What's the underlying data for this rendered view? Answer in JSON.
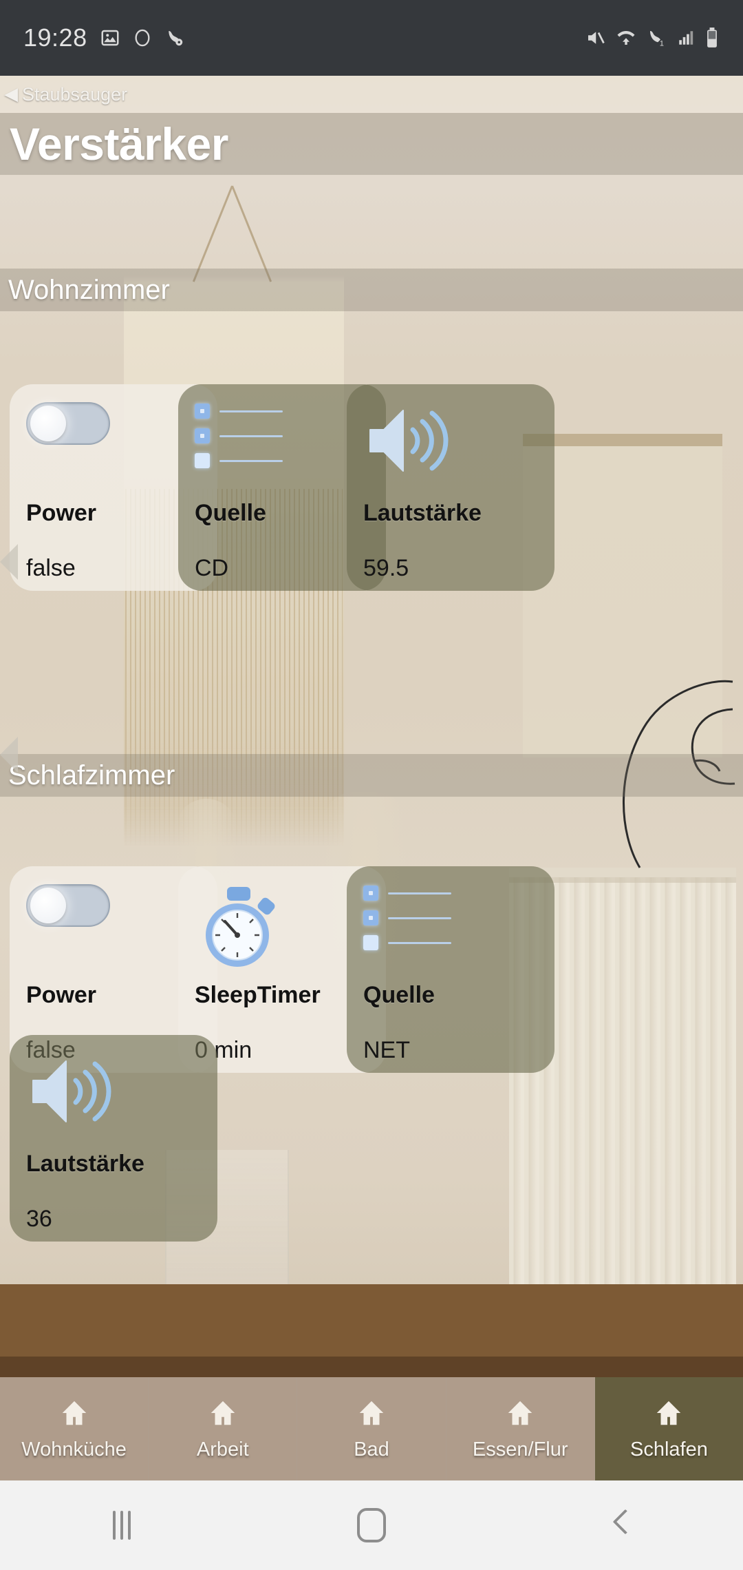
{
  "statusbar": {
    "time": "19:28",
    "left_icons": [
      "image-icon",
      "circle-icon",
      "call-wifi-icon"
    ],
    "right_icons": [
      "mute-icon",
      "wifi-icon",
      "wifi-calling-icon",
      "signal-icon",
      "battery-icon"
    ]
  },
  "nav": {
    "back_label": "Staubsauger",
    "back_caret": "◀"
  },
  "header": {
    "title": "Verstärker"
  },
  "sections": [
    {
      "name": "Wohnzimmer",
      "cards": [
        {
          "label": "Power",
          "value": "false",
          "icon": "toggle-switch-off-icon",
          "style": "light"
        },
        {
          "label": "Quelle",
          "value": "CD",
          "icon": "list-select-icon",
          "style": "olive"
        },
        {
          "label": "Lautstärke",
          "value": "59.5",
          "icon": "speaker-volume-icon",
          "style": "olive"
        }
      ]
    },
    {
      "name": "Schlafzimmer",
      "cards": [
        {
          "label": "Power",
          "value": "false",
          "icon": "toggle-switch-off-icon",
          "style": "light"
        },
        {
          "label": "SleepTimer",
          "value": "0 min",
          "icon": "stopwatch-icon",
          "style": "light"
        },
        {
          "label": "Quelle",
          "value": "NET",
          "icon": "list-select-icon",
          "style": "olive"
        },
        {
          "label": "Lautstärke",
          "value": "36",
          "icon": "speaker-volume-icon",
          "style": "olive"
        }
      ]
    }
  ],
  "tabbar": {
    "items": [
      {
        "label": "Wohnküche",
        "icon": "home-icon",
        "active": false
      },
      {
        "label": "Arbeit",
        "icon": "home-icon",
        "active": false
      },
      {
        "label": "Bad",
        "icon": "home-icon",
        "active": false
      },
      {
        "label": "Essen/Flur",
        "icon": "home-icon",
        "active": false
      },
      {
        "label": "Schlafen",
        "icon": "home-icon",
        "active": true
      }
    ]
  },
  "system_nav": {
    "recents": "recents-icon",
    "home": "home-button-icon",
    "back": "back-icon"
  },
  "colors": {
    "status_bar_bg": "#35383c",
    "card_light_bg": "#f1ece4",
    "card_olive_bg": "#6d6e50",
    "accent_blue": "#8fb6e8",
    "tab_active_bg": "#68694a",
    "overlay_bar": "#787062"
  }
}
